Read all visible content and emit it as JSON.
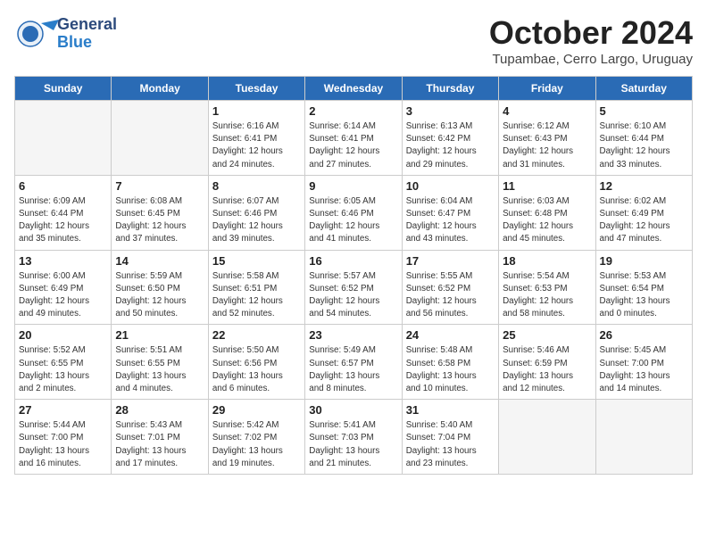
{
  "logo": {
    "general": "General",
    "blue": "Blue"
  },
  "header": {
    "month": "October 2024",
    "location": "Tupambae, Cerro Largo, Uruguay"
  },
  "weekdays": [
    "Sunday",
    "Monday",
    "Tuesday",
    "Wednesday",
    "Thursday",
    "Friday",
    "Saturday"
  ],
  "weeks": [
    [
      {
        "day": "",
        "content": ""
      },
      {
        "day": "",
        "content": ""
      },
      {
        "day": "1",
        "content": "Sunrise: 6:16 AM\nSunset: 6:41 PM\nDaylight: 12 hours\nand 24 minutes."
      },
      {
        "day": "2",
        "content": "Sunrise: 6:14 AM\nSunset: 6:41 PM\nDaylight: 12 hours\nand 27 minutes."
      },
      {
        "day": "3",
        "content": "Sunrise: 6:13 AM\nSunset: 6:42 PM\nDaylight: 12 hours\nand 29 minutes."
      },
      {
        "day": "4",
        "content": "Sunrise: 6:12 AM\nSunset: 6:43 PM\nDaylight: 12 hours\nand 31 minutes."
      },
      {
        "day": "5",
        "content": "Sunrise: 6:10 AM\nSunset: 6:44 PM\nDaylight: 12 hours\nand 33 minutes."
      }
    ],
    [
      {
        "day": "6",
        "content": "Sunrise: 6:09 AM\nSunset: 6:44 PM\nDaylight: 12 hours\nand 35 minutes."
      },
      {
        "day": "7",
        "content": "Sunrise: 6:08 AM\nSunset: 6:45 PM\nDaylight: 12 hours\nand 37 minutes."
      },
      {
        "day": "8",
        "content": "Sunrise: 6:07 AM\nSunset: 6:46 PM\nDaylight: 12 hours\nand 39 minutes."
      },
      {
        "day": "9",
        "content": "Sunrise: 6:05 AM\nSunset: 6:46 PM\nDaylight: 12 hours\nand 41 minutes."
      },
      {
        "day": "10",
        "content": "Sunrise: 6:04 AM\nSunset: 6:47 PM\nDaylight: 12 hours\nand 43 minutes."
      },
      {
        "day": "11",
        "content": "Sunrise: 6:03 AM\nSunset: 6:48 PM\nDaylight: 12 hours\nand 45 minutes."
      },
      {
        "day": "12",
        "content": "Sunrise: 6:02 AM\nSunset: 6:49 PM\nDaylight: 12 hours\nand 47 minutes."
      }
    ],
    [
      {
        "day": "13",
        "content": "Sunrise: 6:00 AM\nSunset: 6:49 PM\nDaylight: 12 hours\nand 49 minutes."
      },
      {
        "day": "14",
        "content": "Sunrise: 5:59 AM\nSunset: 6:50 PM\nDaylight: 12 hours\nand 50 minutes."
      },
      {
        "day": "15",
        "content": "Sunrise: 5:58 AM\nSunset: 6:51 PM\nDaylight: 12 hours\nand 52 minutes."
      },
      {
        "day": "16",
        "content": "Sunrise: 5:57 AM\nSunset: 6:52 PM\nDaylight: 12 hours\nand 54 minutes."
      },
      {
        "day": "17",
        "content": "Sunrise: 5:55 AM\nSunset: 6:52 PM\nDaylight: 12 hours\nand 56 minutes."
      },
      {
        "day": "18",
        "content": "Sunrise: 5:54 AM\nSunset: 6:53 PM\nDaylight: 12 hours\nand 58 minutes."
      },
      {
        "day": "19",
        "content": "Sunrise: 5:53 AM\nSunset: 6:54 PM\nDaylight: 13 hours\nand 0 minutes."
      }
    ],
    [
      {
        "day": "20",
        "content": "Sunrise: 5:52 AM\nSunset: 6:55 PM\nDaylight: 13 hours\nand 2 minutes."
      },
      {
        "day": "21",
        "content": "Sunrise: 5:51 AM\nSunset: 6:55 PM\nDaylight: 13 hours\nand 4 minutes."
      },
      {
        "day": "22",
        "content": "Sunrise: 5:50 AM\nSunset: 6:56 PM\nDaylight: 13 hours\nand 6 minutes."
      },
      {
        "day": "23",
        "content": "Sunrise: 5:49 AM\nSunset: 6:57 PM\nDaylight: 13 hours\nand 8 minutes."
      },
      {
        "day": "24",
        "content": "Sunrise: 5:48 AM\nSunset: 6:58 PM\nDaylight: 13 hours\nand 10 minutes."
      },
      {
        "day": "25",
        "content": "Sunrise: 5:46 AM\nSunset: 6:59 PM\nDaylight: 13 hours\nand 12 minutes."
      },
      {
        "day": "26",
        "content": "Sunrise: 5:45 AM\nSunset: 7:00 PM\nDaylight: 13 hours\nand 14 minutes."
      }
    ],
    [
      {
        "day": "27",
        "content": "Sunrise: 5:44 AM\nSunset: 7:00 PM\nDaylight: 13 hours\nand 16 minutes."
      },
      {
        "day": "28",
        "content": "Sunrise: 5:43 AM\nSunset: 7:01 PM\nDaylight: 13 hours\nand 17 minutes."
      },
      {
        "day": "29",
        "content": "Sunrise: 5:42 AM\nSunset: 7:02 PM\nDaylight: 13 hours\nand 19 minutes."
      },
      {
        "day": "30",
        "content": "Sunrise: 5:41 AM\nSunset: 7:03 PM\nDaylight: 13 hours\nand 21 minutes."
      },
      {
        "day": "31",
        "content": "Sunrise: 5:40 AM\nSunset: 7:04 PM\nDaylight: 13 hours\nand 23 minutes."
      },
      {
        "day": "",
        "content": ""
      },
      {
        "day": "",
        "content": ""
      }
    ]
  ]
}
